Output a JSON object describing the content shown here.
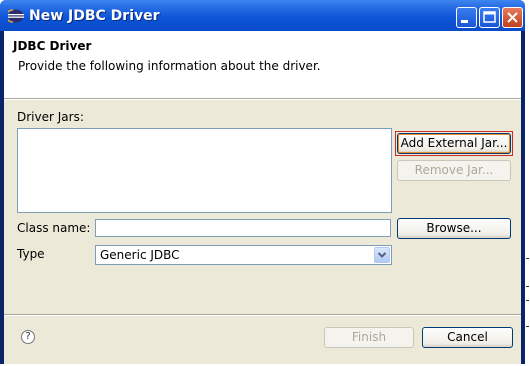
{
  "window": {
    "title": "New JDBC Driver",
    "icon": "eclipse-icon"
  },
  "header": {
    "title": "JDBC Driver",
    "description": "Provide the following information about the driver."
  },
  "driver_jars": {
    "label": "Driver Jars:",
    "items": [],
    "add_button": "Add External Jar...",
    "remove_button": "Remove Jar..."
  },
  "class_name": {
    "label": "Class name:",
    "value": "",
    "browse_button": "Browse..."
  },
  "type": {
    "label": "Type",
    "selected": "Generic JDBC"
  },
  "footer": {
    "help_icon": "help-icon",
    "finish_button": "Finish",
    "cancel_button": "Cancel"
  },
  "colors": {
    "title_bar": "#0b53d6",
    "dialog_bg": "#ece9d8",
    "focus_outline": "#cc2a2a"
  }
}
